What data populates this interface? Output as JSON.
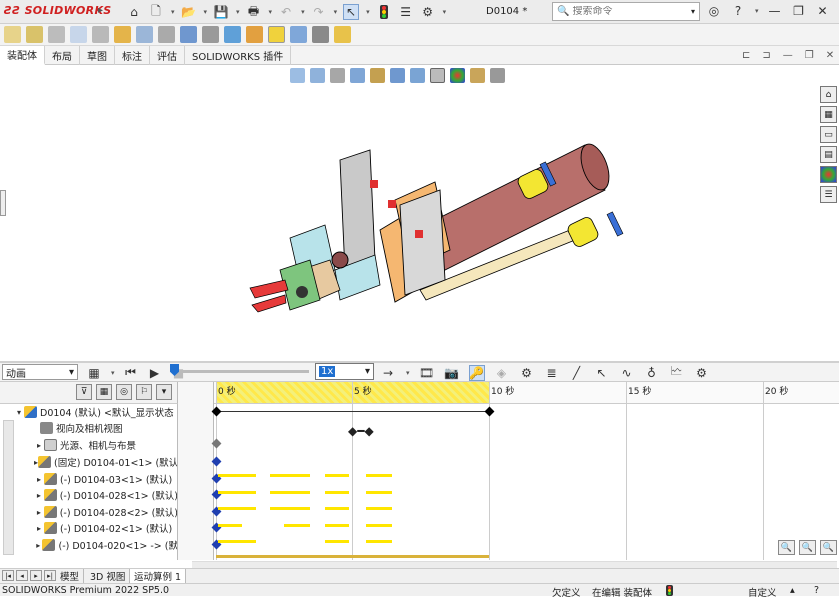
{
  "app": {
    "logo": "SOLIDWORKS",
    "doc_title": "D0104 *"
  },
  "search": {
    "placeholder": "搜索命令"
  },
  "tabs": [
    {
      "label": "装配体",
      "active": true
    },
    {
      "label": "布局"
    },
    {
      "label": "草图"
    },
    {
      "label": "标注"
    },
    {
      "label": "评估"
    },
    {
      "label": "SOLIDWORKS 插件"
    }
  ],
  "motion": {
    "study_type": "动画",
    "speed": "1x",
    "ruler_unit": "秒",
    "ruler_ticks": [
      "0",
      "5",
      "10",
      "15",
      "20"
    ]
  },
  "tree": {
    "rows": [
      {
        "label": "D0104 (默认) <默认_显示状态",
        "icon": "assembly-icon",
        "indent": 1,
        "arrow": "▾"
      },
      {
        "label": "视向及相机视图",
        "icon": "camera-icon",
        "indent": 2,
        "arrow": ""
      },
      {
        "label": "光源、相机与布景",
        "icon": "light-icon",
        "indent": 2,
        "arrow": "▸"
      },
      {
        "label": "(固定) D0104-01<1> (默认)",
        "icon": "part-icon",
        "indent": 2,
        "arrow": "▸"
      },
      {
        "label": "(-) D0104-03<1> (默认)",
        "icon": "part-icon",
        "indent": 2,
        "arrow": "▸"
      },
      {
        "label": "(-) D0104-028<1> (默认)",
        "icon": "part-icon",
        "indent": 2,
        "arrow": "▸"
      },
      {
        "label": "(-) D0104-028<2> (默认)",
        "icon": "part-icon",
        "indent": 2,
        "arrow": "▸"
      },
      {
        "label": "(-) D0104-02<1> (默认)",
        "icon": "part-icon",
        "indent": 2,
        "arrow": "▸"
      },
      {
        "label": "(-) D0104-020<1> -> (默",
        "icon": "part-icon",
        "indent": 2,
        "arrow": "▸"
      }
    ]
  },
  "bottom_tabs": [
    {
      "label": "模型"
    },
    {
      "label": "3D 视图"
    },
    {
      "label": "运动算例 1",
      "active": true
    }
  ],
  "status": {
    "product": "SOLIDWORKS Premium 2022 SP5.0",
    "defined": "欠定义",
    "editing": "在编辑 装配体",
    "custom": "自定义"
  }
}
